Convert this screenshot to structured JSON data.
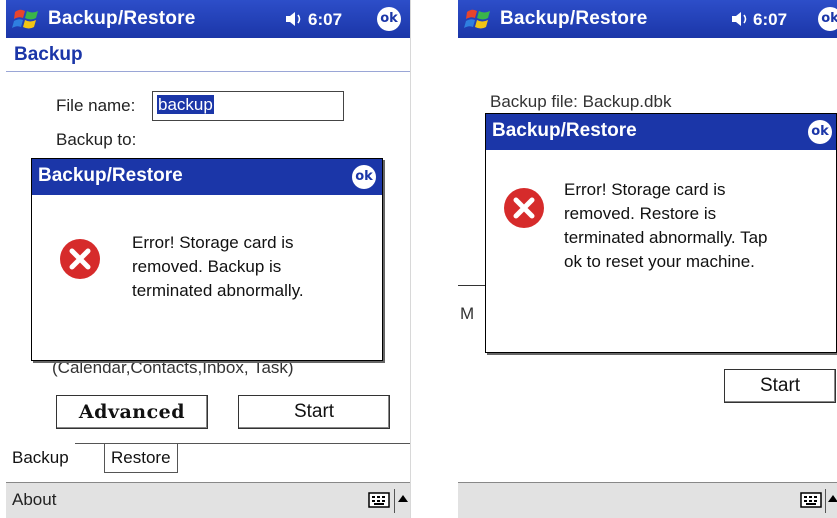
{
  "left": {
    "titlebar": {
      "title": "Backup/Restore",
      "time": "6:07",
      "ok": "ok"
    },
    "subheader": "Backup",
    "file_name_label": "File name:",
    "file_name_value": "backup",
    "backup_to_label": "Backup to:",
    "items_text": "(Calendar,Contacts,Inbox, Task)",
    "advanced_button": "Advanced",
    "start_button": "Start",
    "tabs": [
      "Backup",
      "Restore"
    ],
    "menu": {
      "about": "About"
    },
    "dialog": {
      "title": "Backup/Restore",
      "ok": "ok",
      "message": [
        "Error! Storage card is",
        "removed. Backup is",
        "terminated abnormally."
      ]
    }
  },
  "right": {
    "titlebar": {
      "title": "Backup/Restore",
      "time": "6:07",
      "ok": "ok"
    },
    "backup_file_text": "Backup file: Backup.dbk",
    "partial_label": "M",
    "start_button": "Start",
    "dialog": {
      "title": "Backup/Restore",
      "ok": "ok",
      "message": [
        "Error! Storage card is",
        "removed. Restore is",
        "terminated abnormally. Tap",
        "ok to reset your machine."
      ]
    }
  },
  "colors": {
    "titlebar": "#1b36a8",
    "error": "#d62b2b"
  }
}
